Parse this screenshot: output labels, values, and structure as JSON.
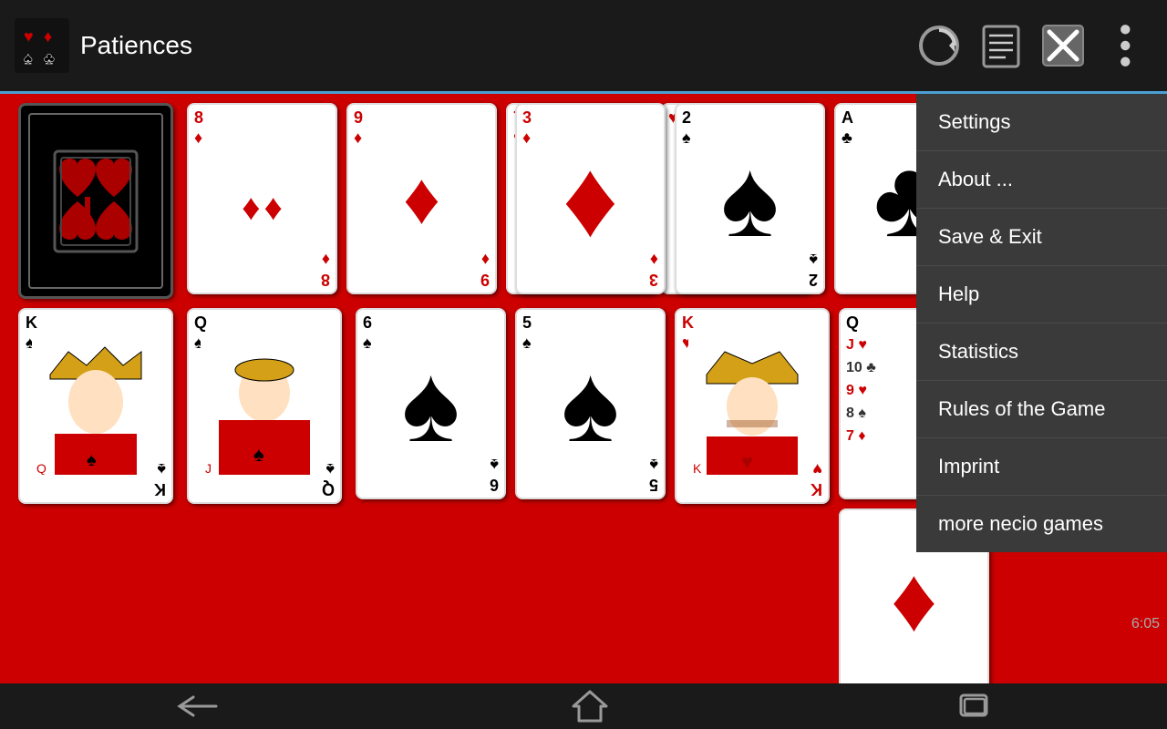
{
  "app": {
    "title": "Patiences",
    "time": "6:05"
  },
  "menu": {
    "items": [
      {
        "id": "settings",
        "label": "Settings"
      },
      {
        "id": "about",
        "label": "About ..."
      },
      {
        "id": "save-exit",
        "label": "Save & Exit"
      },
      {
        "id": "help",
        "label": "Help"
      },
      {
        "id": "statistics",
        "label": "Statistics"
      },
      {
        "id": "rules",
        "label": "Rules of the Game"
      },
      {
        "id": "imprint",
        "label": "Imprint"
      },
      {
        "id": "more-games",
        "label": "more necio games"
      }
    ]
  },
  "toolbar": {
    "refresh_label": "refresh",
    "save_label": "save",
    "exit_label": "exit",
    "more_label": "more"
  },
  "nav": {
    "back_label": "back",
    "home_label": "home",
    "recents_label": "recents"
  }
}
